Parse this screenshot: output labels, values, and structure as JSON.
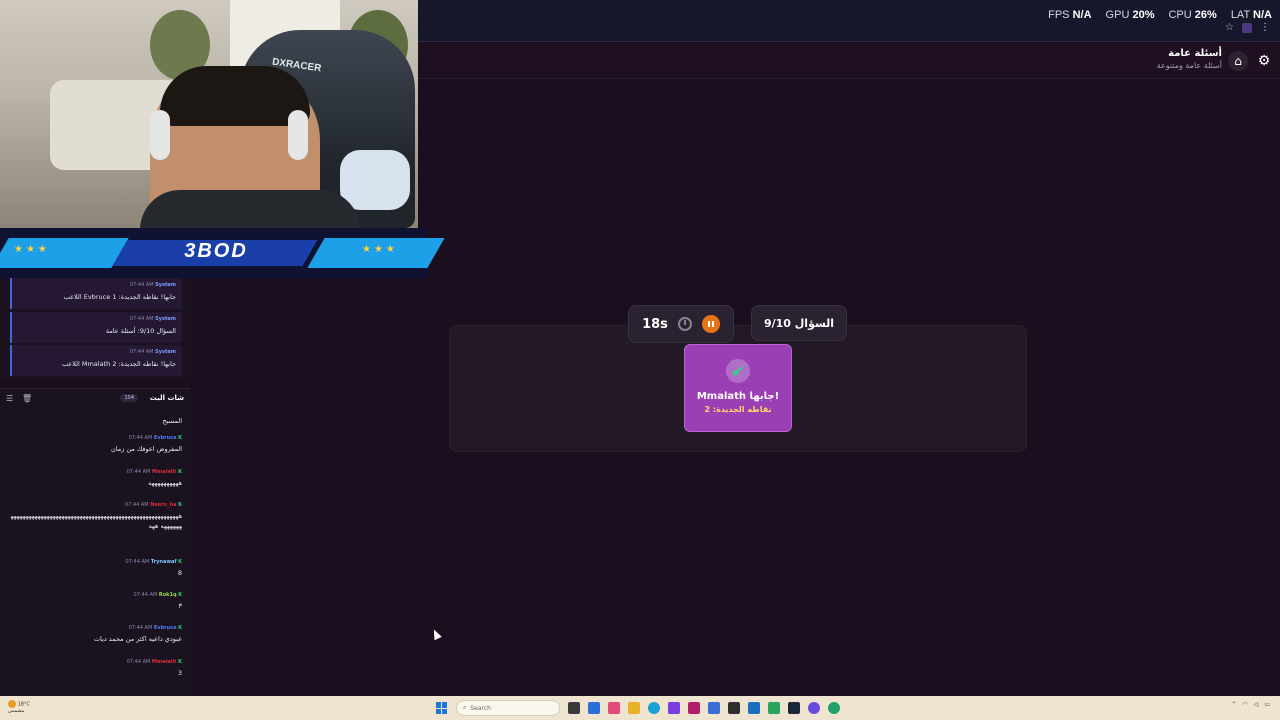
{
  "perf": {
    "fps_label": "FPS",
    "fps_value": "N/A",
    "gpu_label": "GPU",
    "gpu_value": "20%",
    "cpu_label": "CPU",
    "cpu_value": "26%",
    "lat_label": "LAT",
    "lat_value": "N/A"
  },
  "header": {
    "title": "أسئلة عامة",
    "subtitle": "أسئلة عامة ومتنوعة"
  },
  "game": {
    "timer": "18s",
    "question_counter": "السؤال 9/10",
    "result_title": "Mmalath جابها!",
    "result_points": "نقاطه الجديدة: 2"
  },
  "stream_banner": {
    "name": "3BOD",
    "stars_left": "★★★",
    "stars_right": "★★★"
  },
  "system_log": [
    {
      "time": "07:44 AM",
      "sender": "System",
      "text": "اللاعب Evbruce جابها! نقاطه الجديدة: 1"
    },
    {
      "time": "07:44 AM",
      "sender": "System",
      "text": "السؤال 9/10: أسئلة عامة"
    },
    {
      "time": "07:44 AM",
      "sender": "System",
      "text": "اللاعب Mmalath جابها! نقاطه الجديدة: 2"
    }
  ],
  "chat": {
    "title": "شات البث",
    "count": "104",
    "messages": [
      {
        "time": "",
        "user": "",
        "user_color": "#6ea8ff",
        "text": "المسبح"
      },
      {
        "time": "07:44 AM",
        "user": "Evbruce",
        "user_color": "#4f7dff",
        "text": "المفروض اعوفك من زمان"
      },
      {
        "time": "07:44 AM",
        "user": "Mmalath",
        "user_color": "#d92b3a",
        "text": "ههههههههههه"
      },
      {
        "time": "07:44 AM",
        "user": "Neero_ha",
        "user_color": "#d92b3a",
        "text": "هههههههههههههههههههههههههههههههههههههههههههههههههههههههههههههههه ههه"
      },
      {
        "time": "07:44 AM",
        "user": "Trynawaf",
        "user_color": "#7ec8ff",
        "text": "8"
      },
      {
        "time": "07:44 AM",
        "user": "Rok1q",
        "user_color": "#9ad94a",
        "text": "٣"
      },
      {
        "time": "07:44 AM",
        "user": "Evbruce",
        "user_color": "#4f7dff",
        "text": "عبودي داعيه اكثر من محمد ديات"
      },
      {
        "time": "07:44 AM",
        "user": "Mmalath",
        "user_color": "#d92b3a",
        "text": "3"
      }
    ]
  },
  "taskbar": {
    "weather_temp": "18°C",
    "weather_desc": "مشمس",
    "search_placeholder": "Search"
  }
}
